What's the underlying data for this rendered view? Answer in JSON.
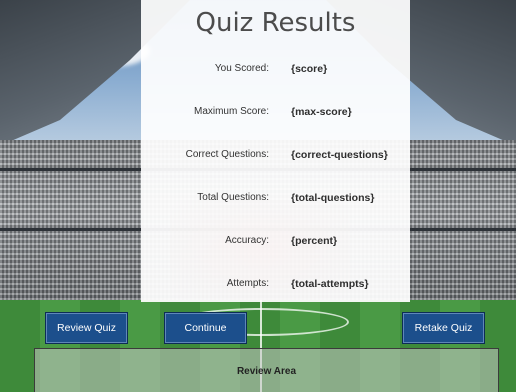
{
  "panel": {
    "title": "Quiz Results",
    "rows": [
      {
        "label": "You Scored:",
        "value": "{score}"
      },
      {
        "label": "Maximum Score:",
        "value": "{max-score}"
      },
      {
        "label": "Correct Questions:",
        "value": "{correct-questions}"
      },
      {
        "label": "Total Questions:",
        "value": "{total-questions}"
      },
      {
        "label": "Accuracy:",
        "value": "{percent}"
      },
      {
        "label": "Attempts:",
        "value": "{total-attempts}"
      }
    ]
  },
  "buttons": {
    "review_quiz": "Review Quiz",
    "continue": "Continue",
    "retake_quiz": "Retake Quiz"
  },
  "review_area": {
    "label": "Review Area"
  },
  "colors": {
    "button": "#1c4f8c",
    "panel": "#ffffff",
    "pitch": "#3e8a3a"
  }
}
